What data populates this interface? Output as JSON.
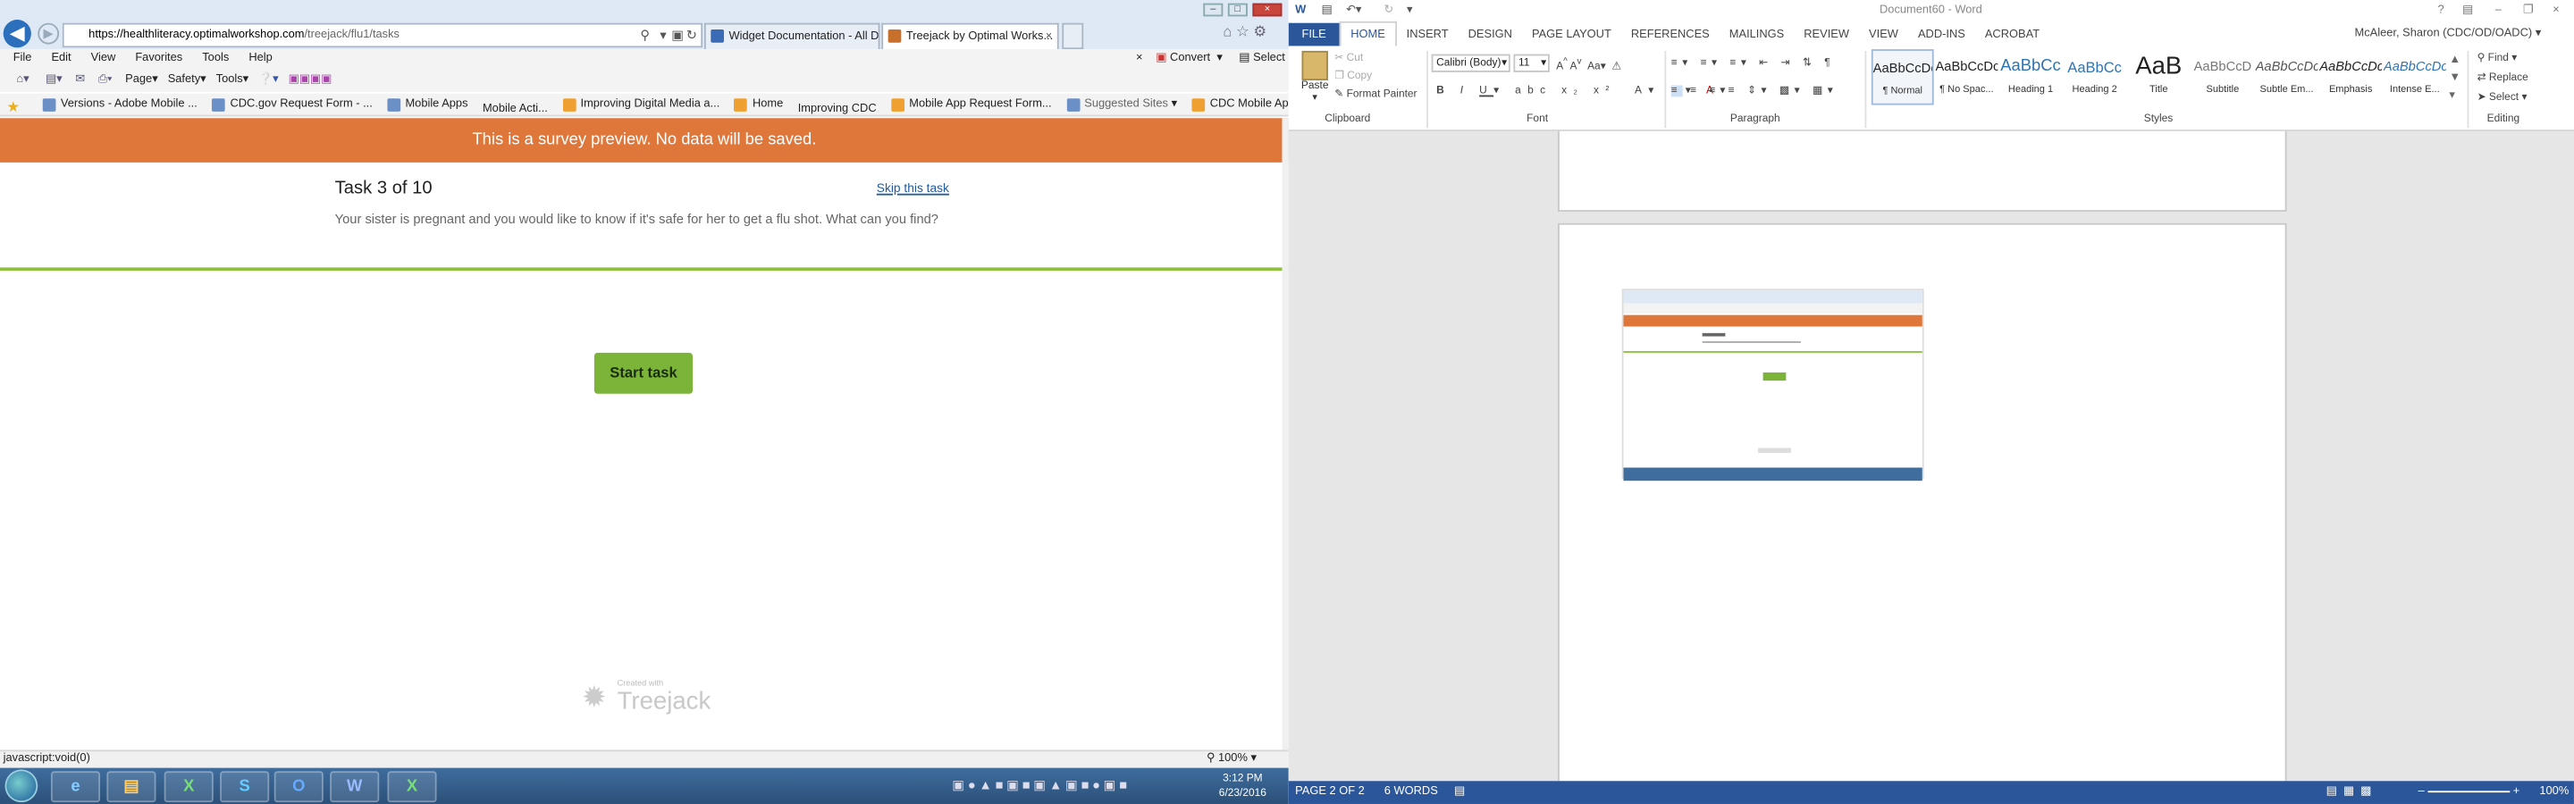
{
  "ie": {
    "address_domain": "https://healthliteracy.optimalworkshop.com",
    "address_path": "/treejack/flu1/tasks",
    "tabs": [
      {
        "label": "Widget Documentation - All D..."
      },
      {
        "label": "Treejack by Optimal Works..."
      }
    ],
    "menu": [
      "File",
      "Edit",
      "View",
      "Favorites",
      "Tools",
      "Help"
    ],
    "menu_right": {
      "close": "×",
      "convert": "Convert",
      "select": "Select"
    },
    "commands": [
      "Page",
      "Safety",
      "Tools"
    ],
    "favorites": [
      "Versions - Adobe Mobile ...",
      "CDC.gov Request Form - ...",
      "Mobile Apps",
      "Mobile Acti...",
      "Improving Digital Media a...",
      "Home",
      "Improving CDC",
      "Mobile App Request Form...",
      "Suggested Sites",
      "CDC Mobile Applications ..."
    ],
    "status_text": "javascript:void(0)",
    "zoom": "100%"
  },
  "survey": {
    "banner": "This is a survey preview. No data will be saved.",
    "task_number": "Task 3 of 10",
    "skip_label": "Skip this task",
    "task_text": "Your sister is pregnant and you would like to know if it's safe for her to get a flu shot. What can you find?",
    "start_label": "Start task",
    "created_with": "Created with",
    "brand": "Treejack"
  },
  "word": {
    "title": "Document60 - Word",
    "user": "McAleer, Sharon (CDC/OD/OADC)",
    "tabs": [
      "FILE",
      "HOME",
      "INSERT",
      "DESIGN",
      "PAGE LAYOUT",
      "REFERENCES",
      "MAILINGS",
      "REVIEW",
      "VIEW",
      "ADD-INS",
      "ACROBAT"
    ],
    "clipboard": {
      "paste": "Paste",
      "cut": "Cut",
      "copy": "Copy",
      "format_painter": "Format Painter",
      "label": "Clipboard"
    },
    "font": {
      "name": "Calibri (Body)",
      "size": "11",
      "label": "Font"
    },
    "paragraph_label": "Paragraph",
    "styles_label": "Styles",
    "styles": [
      {
        "preview": "AaBbCcDc",
        "name": "¶ Normal"
      },
      {
        "preview": "AaBbCcDc",
        "name": "¶ No Spac..."
      },
      {
        "preview": "AaBbCc",
        "name": "Heading 1"
      },
      {
        "preview": "AaBbCc",
        "name": "Heading 2"
      },
      {
        "preview": "AaB",
        "name": "Title"
      },
      {
        "preview": "AaBbCcD",
        "name": "Subtitle"
      },
      {
        "preview": "AaBbCcDc",
        "name": "Subtle Em..."
      },
      {
        "preview": "AaBbCcDc",
        "name": "Emphasis"
      },
      {
        "preview": "AaBbCcDc",
        "name": "Intense E..."
      }
    ],
    "editing": {
      "find": "Find",
      "replace": "Replace",
      "select": "Select",
      "label": "Editing"
    },
    "status": {
      "page": "PAGE 2 OF 2",
      "words": "6 WORDS",
      "zoom": "100%"
    }
  },
  "taskbar": {
    "time": "3:12 PM",
    "date": "6/23/2016"
  },
  "colors": {
    "banner": "#e0773a",
    "start_button": "#7cb43a",
    "divider": "#8dc03f",
    "word_blue": "#2b579a"
  }
}
